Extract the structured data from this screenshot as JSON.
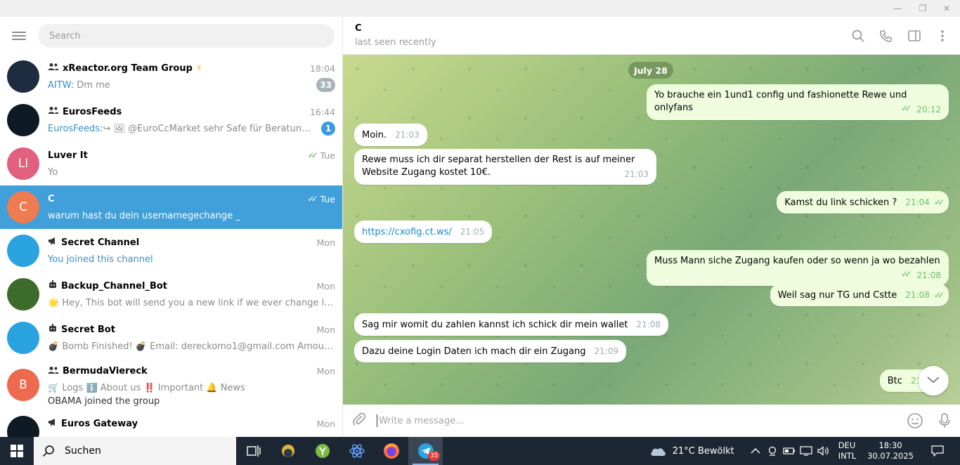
{
  "window": {
    "minimize": "—",
    "restore": "❐",
    "close": "✕"
  },
  "search": {
    "placeholder": "Search"
  },
  "chats": [
    {
      "name": "xReactor.org Team Group",
      "type": "group",
      "suffix": "⚡",
      "time": "18:04",
      "sender": "AITW:",
      "preview": " Dm me",
      "badge": "33",
      "badge_color": "#a8b2ba",
      "avatar_color": "#1d2c3e",
      "avatar_text": ""
    },
    {
      "name": "EurosFeeds",
      "type": "group",
      "time": "16:44",
      "sender": "EurosFeeds:",
      "preview": "↪ 🖼 @EuroCcMarket sehr Safe für Beratung von …",
      "badge": "1",
      "badge_color": "#3a9be0",
      "avatar_color": "#0e1a24",
      "avatar_text": ""
    },
    {
      "name": "Luver It",
      "type": "user",
      "time": "Tue",
      "ticks": true,
      "preview": "Yo",
      "avatar_color": "#e0607e",
      "avatar_text": "LI"
    },
    {
      "name": "C",
      "type": "user",
      "time": "Tue",
      "ticks": true,
      "preview": "warum hast du dein usernamegechange _",
      "avatar_color": "#ef7c51",
      "avatar_text": "C",
      "active": true
    },
    {
      "name": "Secret Channel",
      "type": "channel",
      "time": "Mon",
      "preview": "You joined this channel",
      "preview_blue": true,
      "avatar_color": "#2aa3e0",
      "avatar_text": ""
    },
    {
      "name": "Backup_Channel_Bot",
      "type": "bot",
      "time": "Mon",
      "preview": "🌟 Hey, This bot will send you a new link if we ever change location…",
      "avatar_color": "#3d6b2a",
      "avatar_text": ""
    },
    {
      "name": "Secret Bot",
      "type": "bot",
      "time": "Mon",
      "preview": "💣 Bomb Finished! 💣 Email: dereckomo1@gmail.com Amount: 10…",
      "avatar_color": "#2aa3e0",
      "avatar_text": ""
    },
    {
      "name": "BermudaViereck",
      "type": "group",
      "time": "Mon",
      "preview": "🛒 Logs  ℹ️ About us  ‼️ Important  🔔 News",
      "preview2": "OBAMA joined the group",
      "avatar_color": "#ee6a4e",
      "avatar_text": "B"
    },
    {
      "name": "Euros Gateway",
      "type": "channel",
      "time": "Mon",
      "preview": "",
      "avatar_color": "#0e1a24",
      "avatar_text": ""
    }
  ],
  "header": {
    "name": "C",
    "status": "last seen recently"
  },
  "date_pill": "July 28",
  "messages": [
    {
      "dir": "out",
      "text": "Yo brauche ein 1und1 config und fashionette Rewe und onlyfans",
      "time": "20:12"
    },
    {
      "dir": "in",
      "text": "Moin.",
      "time": "21:03"
    },
    {
      "dir": "in",
      "text": "Rewe muss ich dir separat herstellen der Rest is auf meiner Website Zugang kostet 10€.",
      "time": "21:03"
    },
    {
      "dir": "out",
      "text": "Kamst du link schicken ?",
      "time": "21:04"
    },
    {
      "dir": "in",
      "text": "https://cxofig.ct.ws/",
      "time": "21:05",
      "link": true
    },
    {
      "dir": "out",
      "text": "Muss Mann siche Zugang kaufen oder so wenn ja wo bezahlen",
      "time": "21:08"
    },
    {
      "dir": "out",
      "text": "Weil sag nur TG und Cstte",
      "time": "21:08"
    },
    {
      "dir": "in",
      "text": "Sag mir womit du zahlen kannst ich schick dir mein wallet",
      "time": "21:08"
    },
    {
      "dir": "in",
      "text": "Dazu deine Login Daten ich mach dir ein Zugang",
      "time": "21:09"
    },
    {
      "dir": "out",
      "text": "Btc",
      "time": "21:0"
    }
  ],
  "composer": {
    "placeholder": "Write a message..."
  },
  "taskbar": {
    "search_label": "Suchen",
    "weather": "21°C  Bewölkt",
    "lang_line1": "DEU",
    "lang_line2": "INTL",
    "time": "18:30",
    "date": "30.07.2025",
    "telegram_badge": "35"
  }
}
